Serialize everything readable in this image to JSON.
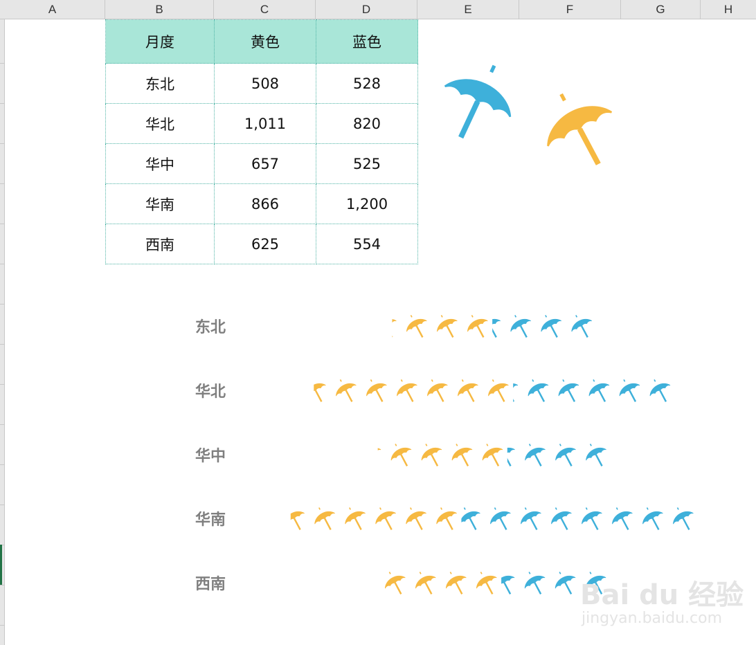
{
  "spreadsheet": {
    "columns": [
      "A",
      "B",
      "C",
      "D",
      "E",
      "F",
      "G",
      "H"
    ]
  },
  "table": {
    "headers": [
      "月度",
      "黄色",
      "蓝色"
    ],
    "rows": [
      [
        "东北",
        "508",
        "528"
      ],
      [
        "华北",
        "1,011",
        "820"
      ],
      [
        "华中",
        "657",
        "525"
      ],
      [
        "华南",
        "866",
        "1,200"
      ],
      [
        "西南",
        "625",
        "554"
      ]
    ]
  },
  "chart_data": {
    "type": "bar",
    "orientation": "horizontal",
    "stacked": true,
    "pictograph": "umbrella-icon",
    "categories": [
      "东北",
      "华北",
      "华中",
      "华南",
      "西南"
    ],
    "series": [
      {
        "name": "黄色",
        "color": "#f6b942",
        "values": [
          508,
          1011,
          657,
          866,
          625
        ]
      },
      {
        "name": "蓝色",
        "color": "#3eb0da",
        "values": [
          528,
          820,
          525,
          1200,
          554
        ]
      }
    ],
    "axis_visible": false,
    "grid": false,
    "legend": "none"
  },
  "decor": {
    "icons": [
      "umbrella-icon",
      "umbrella-icon"
    ],
    "colors": {
      "blue": "#3eb0da",
      "yellow": "#f6b942"
    }
  },
  "watermark": {
    "main": "Bai du 经验",
    "sub": "jingyan.baidu.com"
  }
}
